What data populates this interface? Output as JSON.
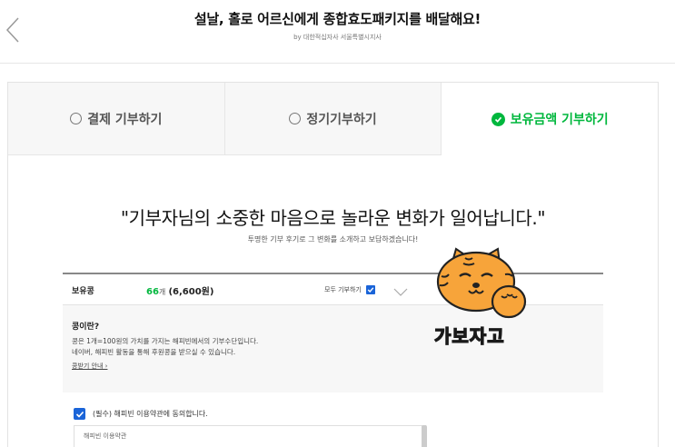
{
  "header": {
    "title": "설날, 홀로 어르신에게 종합효도패키지를 배달해요!",
    "subtitle": "by 대한적십자사 서울특별시지사"
  },
  "tabs": [
    {
      "label": "결제 기부하기",
      "active": false
    },
    {
      "label": "정기기부하기",
      "active": false
    },
    {
      "label": "보유금액 기부하기",
      "active": true
    }
  ],
  "main": {
    "headline": "\"기부자님의 소중한 마음으로 놀라운 변화가 일어납니다.\"",
    "subline": "투명한 기부 후기로 그 변화를 소개하고 보답하겠습니다!"
  },
  "bean": {
    "label": "보유콩",
    "count": "66",
    "unit": "개",
    "won": "(6,600원)",
    "all_donate": "모두 기부하기"
  },
  "info": {
    "title": "콩이란?",
    "line1": "콩은 1개=100원의 가치를 가지는 해피빈에서의 기부수단입니다.",
    "line2": "네이버, 해피빈 활동을 통해 후원콩을 받으실 수 있습니다.",
    "link": "콩받기 안내 ›"
  },
  "agree": {
    "label": "(필수) 해피빈 이용약관에 동의합니다.",
    "terms_title": "해피빈 이용약관"
  },
  "sticker": {
    "text": "가보자고"
  },
  "colors": {
    "accent_green": "#00b73d",
    "check_blue": "#1a64d8",
    "tiger_orange": "#f7a43a"
  }
}
